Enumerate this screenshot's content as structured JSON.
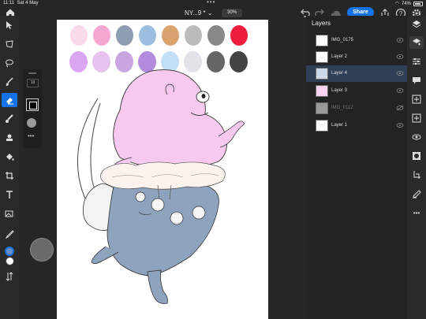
{
  "status": {
    "time": "11:11",
    "date": "Sat 4 May",
    "battery": "74%"
  },
  "document": {
    "title": "NY...9 *",
    "zoom": "30%"
  },
  "header": {
    "share_label": "Share"
  },
  "brush": {
    "size": "10"
  },
  "layers": {
    "title": "Layers",
    "items": [
      {
        "name": "IMG_0175",
        "dim": false
      },
      {
        "name": "Layer 2",
        "dim": false
      },
      {
        "name": "Layer 4",
        "dim": false,
        "selected": true
      },
      {
        "name": "Layer 3",
        "dim": false
      },
      {
        "name": "IMG_0112",
        "dim": true
      },
      {
        "name": "Layer 1",
        "dim": false
      }
    ]
  },
  "palette": {
    "row1": [
      "#f9d9ea",
      "#f5a7d2",
      "#8e9db1",
      "#9cbfdf",
      "#d9a36f",
      "#bbbbbb",
      "#888888",
      "#ee1c3e"
    ],
    "row2": [
      "#dba6f1",
      "#e8c2ef",
      "#c9a6e0",
      "#b28bdd",
      "#c3dff8",
      "#e2e3e8",
      "#666666",
      "#444444"
    ]
  },
  "colors": {
    "accent": "#1473e6",
    "foreground": "#6a8fc2",
    "background": "#ffffff"
  }
}
